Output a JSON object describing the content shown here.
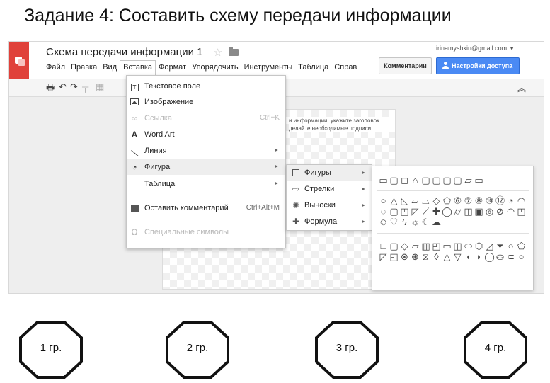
{
  "slide_title": "Задание 4: Составить схему передачи информации",
  "app": {
    "doc_title": "Схема передачи информации 1",
    "user_email": "irinamyshkin@gmail.com",
    "comments_label": "Комментарии",
    "share_label": "Настройки доступа",
    "accent_color": "#4a8af4",
    "logo_color": "#e0413a",
    "menu": [
      {
        "label": "Файл"
      },
      {
        "label": "Правка"
      },
      {
        "label": "Вид"
      },
      {
        "label": "Вставка",
        "active": true
      },
      {
        "label": "Формат"
      },
      {
        "label": "Упорядочить"
      },
      {
        "label": "Инструменты"
      },
      {
        "label": "Таблица"
      },
      {
        "label": "Справ"
      }
    ],
    "toolbar_icons": [
      "print-icon",
      "undo-icon",
      "redo-icon",
      "paint-format-icon",
      "select-icon",
      "collapse-up-icon"
    ],
    "slide_text": "и информации: укажите заголовок делайте необходимые подписи"
  },
  "insert_menu": {
    "items": [
      {
        "label": "Текстовое поле",
        "icon": "textbox-icon"
      },
      {
        "label": "Изображение",
        "icon": "image-icon"
      },
      {
        "label": "Ссылка",
        "icon": "link-icon",
        "shortcut": "Ctrl+K",
        "disabled": true
      },
      {
        "label": "Word Art",
        "icon": "wordart-icon"
      },
      {
        "label": "Линия",
        "icon": "line-icon",
        "submenu": true
      },
      {
        "label": "Фигура",
        "icon": "shape-icon",
        "submenu": true,
        "highlighted": true
      },
      {
        "label": "Таблица",
        "icon": "",
        "submenu": true
      },
      {
        "label": "Оставить комментарий",
        "icon": "comment-icon",
        "shortcut": "Ctrl+Alt+M"
      },
      {
        "label": "Специальные символы",
        "icon": "omega-icon",
        "disabled": true
      }
    ]
  },
  "shape_submenu": {
    "items": [
      {
        "label": "Фигуры",
        "icon": "square-icon",
        "highlighted": true
      },
      {
        "label": "Стрелки",
        "icon": "arrow-icon"
      },
      {
        "label": "Выноски",
        "icon": "callout-icon"
      },
      {
        "label": "Формула",
        "icon": "plus-icon"
      }
    ]
  },
  "groups": [
    {
      "label": "1 гр."
    },
    {
      "label": "2 гр."
    },
    {
      "label": "3 гр."
    },
    {
      "label": "4 гр."
    }
  ]
}
